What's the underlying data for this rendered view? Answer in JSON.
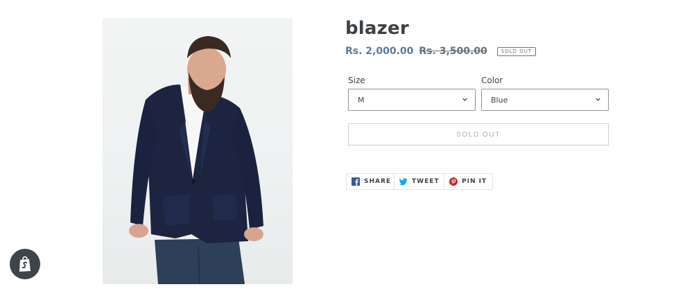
{
  "product": {
    "title": "blazer",
    "price_sale": "Rs. 2,000.00",
    "price_regular": "Rs. 3,500.00",
    "badge": "SOLD OUT",
    "image_icon": "product-photo-blazer-man"
  },
  "options": {
    "size": {
      "label": "Size",
      "selected": "M"
    },
    "color": {
      "label": "Color",
      "selected": "Blue"
    }
  },
  "cart": {
    "button_label": "SOLD OUT"
  },
  "social": {
    "share": {
      "label": "SHARE",
      "icon": "facebook-icon",
      "color": "#3b5998"
    },
    "tweet": {
      "label": "TWEET",
      "icon": "twitter-icon",
      "color": "#00aced"
    },
    "pin": {
      "label": "PIN IT",
      "icon": "pinterest-icon",
      "color": "#cb2027"
    }
  },
  "shopify_badge": {
    "icon": "shopify-bag-icon"
  }
}
